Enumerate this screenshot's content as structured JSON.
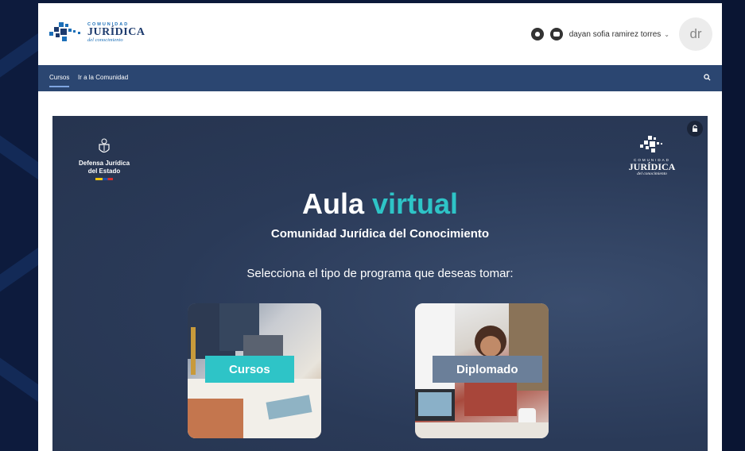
{
  "brand": {
    "small": "COMUNIDAD",
    "main": "JURÍDICA",
    "sub": "del conocimiento"
  },
  "user": {
    "name": "dayan sofia ramirez torres",
    "caret": "⌄",
    "initials": "dr"
  },
  "nav": {
    "items": [
      {
        "label": "Cursos"
      },
      {
        "label": "Ir a la Comunidad"
      }
    ]
  },
  "banner": {
    "defensa": [
      "Defensa Jurídica",
      "del Estado"
    ],
    "logo_small": "COMUNIDAD",
    "logo_main": "JURÍDICA",
    "logo_sub": "del conocimiento",
    "title_part1": "Aula",
    "title_part2": "virtual",
    "subtitle": "Comunidad Jurídica del Conocimiento",
    "prompt": "Selecciona el tipo de programa que deseas tomar:",
    "cards": [
      {
        "label": "Cursos"
      },
      {
        "label": "Diplomado"
      }
    ]
  },
  "colors": {
    "navbar": "#2b4671",
    "accent": "#2ec4c7",
    "banner": "#2a3a58",
    "diplomado_label": "#6b7f99"
  },
  "icons": [
    "notification-bell-icon",
    "chat-icon",
    "search-icon",
    "lock-icon",
    "shield-emblem-icon"
  ]
}
